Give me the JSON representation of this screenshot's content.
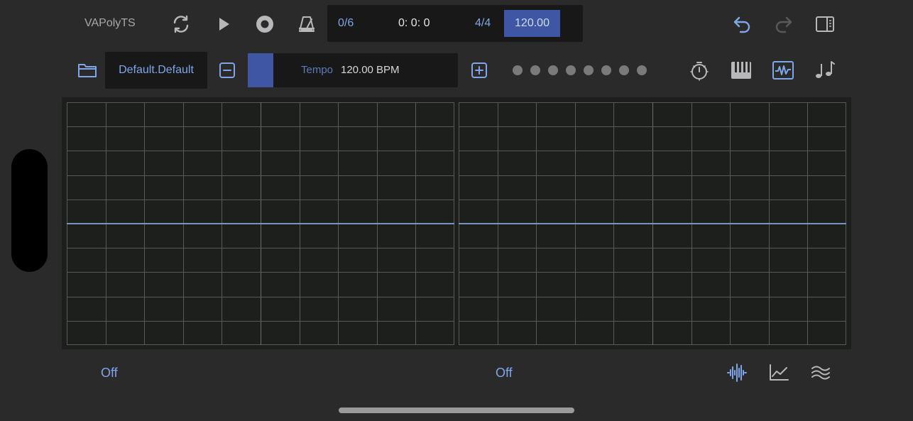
{
  "app": {
    "title": "VAPolyTS"
  },
  "transport": {
    "bars": "0/6",
    "time": "0: 0: 0",
    "time_signature": "4/4",
    "bpm": "120.00"
  },
  "toolbar": {
    "icons": {
      "loop": "loop-icon",
      "play": "play-icon",
      "record": "record-icon",
      "metronome": "metronome-icon",
      "undo": "undo-icon",
      "redo": "redo-icon",
      "sidebar": "sidebar-toggle-icon"
    }
  },
  "preset": {
    "name": "Default.Default"
  },
  "tempo": {
    "label": "Tempo",
    "value": "120.00 BPM",
    "fill_fraction": 0.12
  },
  "page_dots": {
    "count": 8
  },
  "views": {
    "icons": [
      "timer-icon",
      "keyboard-icon",
      "oscilloscope-icon",
      "music-notes-icon"
    ]
  },
  "scopes": [
    {
      "status": "Off"
    },
    {
      "status": "Off"
    }
  ],
  "bottom_icons": [
    "waveform-icon",
    "line-graph-icon",
    "spectrum-icon"
  ],
  "colors": {
    "background": "#2a2a2b",
    "panel": "#181818",
    "accent": "#7fa6e8",
    "accent_fill": "#3e56a3",
    "scope_bg": "#1d1f1d",
    "scope_grid": "#555a55",
    "trace": "#8fb0e6"
  }
}
